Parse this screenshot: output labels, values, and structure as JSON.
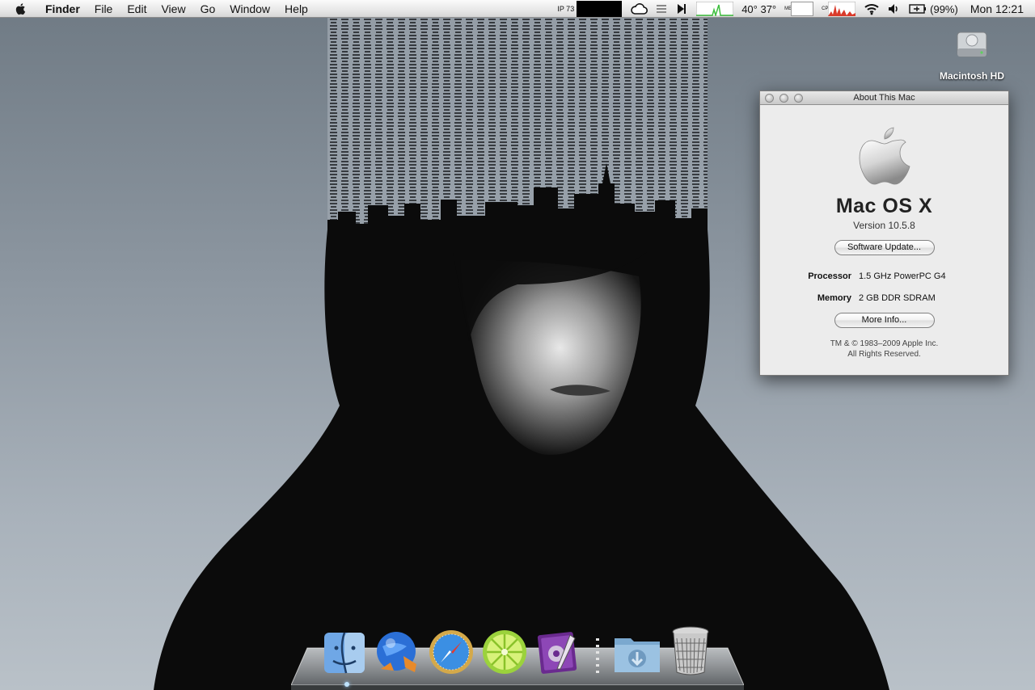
{
  "menubar": {
    "app_name": "Finder",
    "menus": [
      "File",
      "Edit",
      "View",
      "Go",
      "Window",
      "Help"
    ],
    "ip_label": "IP 73",
    "temperature": "40° 37°",
    "mem_label": "MEM",
    "cpu_label": "CPU",
    "battery_percent": "(99%)",
    "clock": "Mon 12:21"
  },
  "desktop": {
    "hd_label": "Macintosh HD"
  },
  "about_window": {
    "title": "About This Mac",
    "os_name": "Mac OS X",
    "version": "Version 10.5.8",
    "software_update_label": "Software Update...",
    "processor_label": "Processor",
    "processor_value": "1.5 GHz PowerPC G4",
    "memory_label": "Memory",
    "memory_value": "2 GB DDR SDRAM",
    "more_info_label": "More Info...",
    "copyright_line1": "TM & © 1983–2009 Apple Inc.",
    "copyright_line2": "All Rights Reserved."
  },
  "dock": {
    "items": [
      "finder-icon",
      "camino-browser-icon",
      "safari-icon",
      "limewire-icon",
      "script-editor-icon",
      "downloads-folder-icon",
      "trash-icon"
    ]
  },
  "colors": {
    "wallpaper_top": "#6f7a84",
    "wallpaper_bottom": "#b9c1c8",
    "hood": "#0b0b0b",
    "accent_red": "#d93a2a",
    "meter_green": "#3fbf3f"
  }
}
